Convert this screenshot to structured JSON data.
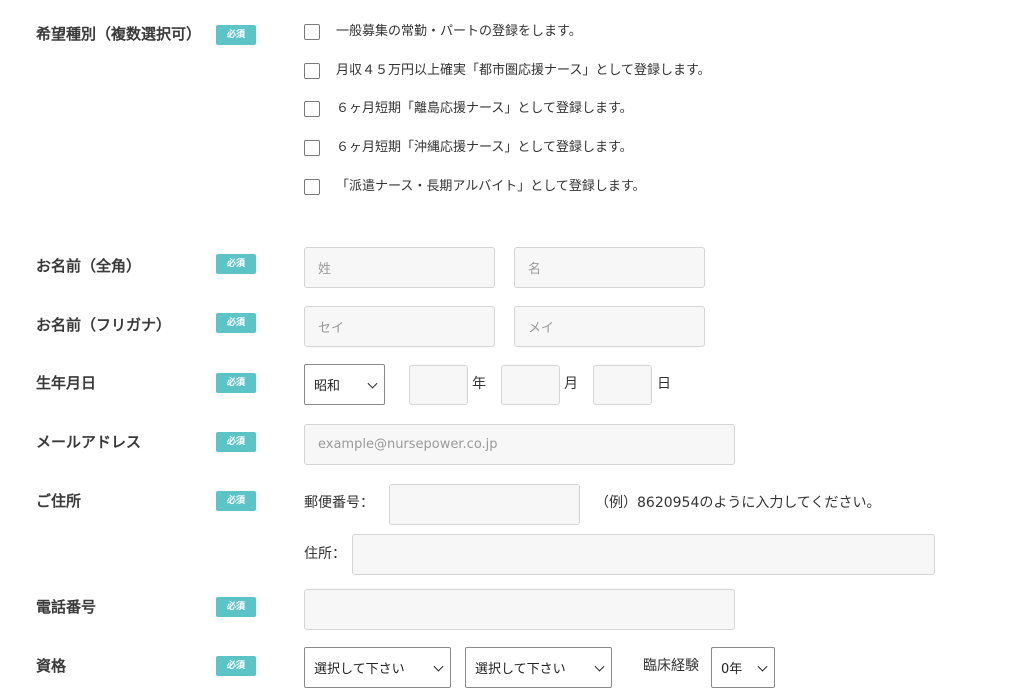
{
  "required_badge": "必須",
  "desired_type": {
    "label": "希望種別（複数選択可）",
    "options": [
      "一般募集の常勤・パートの登録をします。",
      "月収４５万円以上確実「都市圏応援ナース」として登録します。",
      "６ヶ月短期「離島応援ナース」として登録します。",
      "６ヶ月短期「沖縄応援ナース」として登録します。",
      "「派遣ナース・長期アルバイト」として登録します。"
    ]
  },
  "name_fullwidth": {
    "label": "お名前（全角）",
    "last_placeholder": "姓",
    "first_placeholder": "名"
  },
  "name_kana": {
    "label": "お名前（フリガナ）",
    "last_placeholder": "セイ",
    "first_placeholder": "メイ"
  },
  "birthdate": {
    "label": "生年月日",
    "era_value": "昭和",
    "year_unit": "年",
    "month_unit": "月",
    "day_unit": "日"
  },
  "email": {
    "label": "メールアドレス",
    "placeholder": "example@nursepower.co.jp"
  },
  "address": {
    "label": "ご住所",
    "postal_label": "郵便番号：",
    "postal_hint": "（例）8620954のように入力してください。",
    "address_label": "住所："
  },
  "phone": {
    "label": "電話番号"
  },
  "qualification": {
    "label": "資格",
    "select1_value": "選択して下さい",
    "select2_value": "選択して下さい",
    "clinical_label": "臨床経験",
    "clinical_value": "0年"
  }
}
